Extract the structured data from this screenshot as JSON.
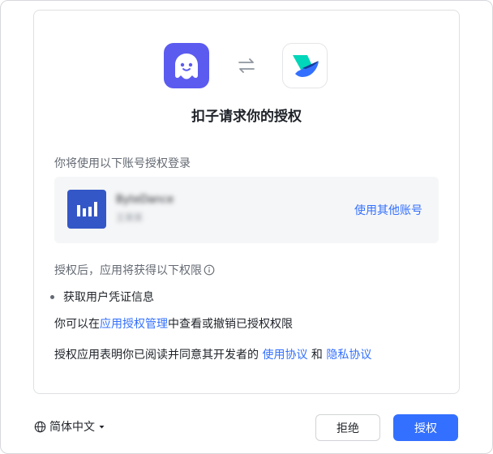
{
  "dialog": {
    "title": "扣子请求你的授权",
    "subtitle": "你将使用以下账号授权登录",
    "account": {
      "name": "ByteDance",
      "subtext": "王某某",
      "switch_label": "使用其他账号"
    },
    "permissions": {
      "heading": "授权后，应用将获得以下权限",
      "items": [
        "获取用户凭证信息"
      ]
    },
    "manage": {
      "prefix": "你可以在",
      "link": "应用授权管理",
      "suffix": "中查看或撤销已授权权限"
    },
    "agreement": {
      "prefix": "授权应用表明你已阅读并同意其开发者的 ",
      "terms_link": "使用协议",
      "and": " 和 ",
      "privacy_link": "隐私协议"
    }
  },
  "footer": {
    "language": "简体中文",
    "reject_label": "拒绝",
    "authorize_label": "授权"
  },
  "colors": {
    "accent": "#3370ff",
    "app_icon_bg": "#5b5bf0",
    "avatar_bg": "#3457c7"
  },
  "icons": {
    "left_app": "ghost-mascot-icon",
    "swap": "swap-arrows-icon",
    "right_app": "lark-bird-icon",
    "info": "info-icon",
    "language": "globe-icon",
    "dropdown": "caret-down-icon"
  }
}
